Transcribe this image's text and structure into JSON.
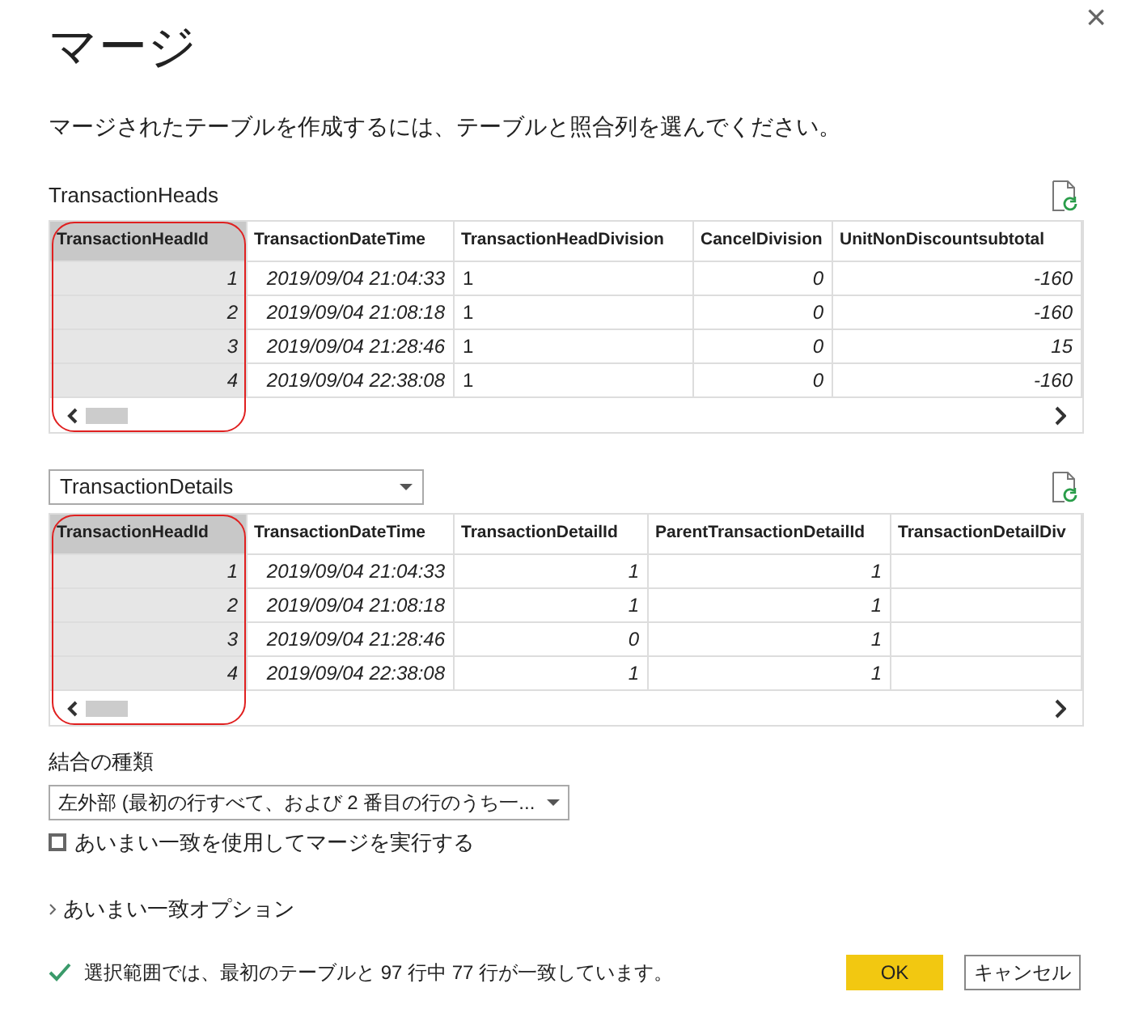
{
  "window": {
    "title": "マージ",
    "close": "×"
  },
  "instruction": "マージされたテーブルを作成するには、テーブルと照合列を選んでください。",
  "tables": [
    {
      "label": "TransactionHeads",
      "kind": "label",
      "columns": [
        {
          "header": "TransactionHeadId",
          "kind": "number",
          "selected": true,
          "highlighted": true
        },
        {
          "header": "TransactionDateTime",
          "kind": "datetime",
          "selected": false,
          "highlighted": false
        },
        {
          "header": "TransactionHeadDivision",
          "kind": "text",
          "selected": false,
          "highlighted": false
        },
        {
          "header": "CancelDivision",
          "kind": "number",
          "selected": false,
          "highlighted": false
        },
        {
          "header": "UnitNonDiscountsubtotal",
          "kind": "number",
          "selected": false,
          "highlighted": false
        }
      ],
      "rows": [
        [
          "1",
          "2019/09/04 21:04:33",
          "1",
          "0",
          "-160"
        ],
        [
          "2",
          "2019/09/04 21:08:18",
          "1",
          "0",
          "-160"
        ],
        [
          "3",
          "2019/09/04 21:28:46",
          "1",
          "0",
          "15"
        ],
        [
          "4",
          "2019/09/04 22:38:08",
          "1",
          "0",
          "-160"
        ]
      ]
    },
    {
      "label": "TransactionDetails",
      "kind": "dropdown",
      "columns": [
        {
          "header": "TransactionHeadId",
          "kind": "number",
          "selected": true,
          "highlighted": true
        },
        {
          "header": "TransactionDateTime",
          "kind": "datetime",
          "selected": false,
          "highlighted": false
        },
        {
          "header": "TransactionDetailId",
          "kind": "number",
          "selected": false,
          "highlighted": false
        },
        {
          "header": "ParentTransactionDetailId",
          "kind": "number",
          "selected": false,
          "highlighted": false
        },
        {
          "header": "TransactionDetailDiv",
          "kind": "number",
          "selected": false,
          "highlighted": false
        }
      ],
      "rows": [
        [
          "1",
          "2019/09/04 21:04:33",
          "1",
          "1"
        ],
        [
          "2",
          "2019/09/04 21:08:18",
          "1",
          "1"
        ],
        [
          "3",
          "2019/09/04 21:28:46",
          "0",
          "1"
        ],
        [
          "4",
          "2019/09/04 22:38:08",
          "1",
          "1"
        ]
      ]
    }
  ],
  "join_kind": {
    "label": "結合の種類",
    "value": "左外部 (最初の行すべて、および 2 番目の行のうち一..."
  },
  "fuzzy_checkbox": {
    "label": "あいまい一致を使用してマージを実行する",
    "checked": false
  },
  "fuzzy_options": {
    "label": "あいまい一致オプション",
    "expanded": false
  },
  "status": "選択範囲では、最初のテーブルと 97 行中 77 行が一致しています。",
  "buttons": [
    {
      "label": "OK",
      "kind": "primary"
    },
    {
      "label": "キャンセル",
      "kind": "secondary"
    }
  ]
}
